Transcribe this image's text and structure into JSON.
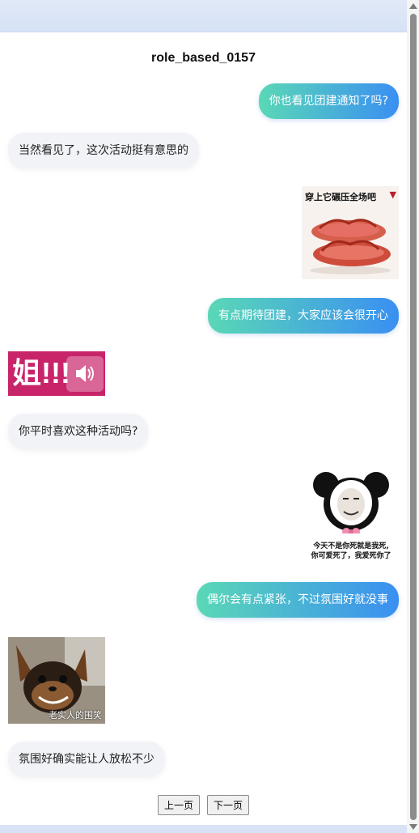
{
  "header": {
    "title": "role_based_0157"
  },
  "messages": [
    {
      "side": "right",
      "type": "text",
      "text": "你也看见团建通知了吗?"
    },
    {
      "side": "left",
      "type": "text",
      "text": "当然看见了，这次活动挺有意思的"
    },
    {
      "side": "right",
      "type": "image",
      "caption": "穿上它碾压全场吧"
    },
    {
      "side": "right",
      "type": "text",
      "text": "有点期待团建，大家应该会很开心"
    },
    {
      "side": "left",
      "type": "image",
      "caption": "姐!!!"
    },
    {
      "side": "left",
      "type": "text",
      "text": "你平时喜欢这种活动吗?"
    },
    {
      "side": "right",
      "type": "image",
      "caption_line1": "今天不是你死就是我死,",
      "caption_line2": "你可爱死了，我爱死你了"
    },
    {
      "side": "right",
      "type": "text",
      "text": "偶尔会有点紧张，不过氛围好就没事"
    },
    {
      "side": "left",
      "type": "image",
      "caption": "老实人的围笑"
    },
    {
      "side": "left",
      "type": "text",
      "text": "氛围好确实能让人放松不少"
    }
  ],
  "pager": {
    "prev_label": "上一页",
    "next_label": "下一页"
  },
  "colors": {
    "bubble_right_start": "#5ad8b6",
    "bubble_right_end": "#3a8ff2",
    "bubble_left": "#f1f3f7"
  }
}
